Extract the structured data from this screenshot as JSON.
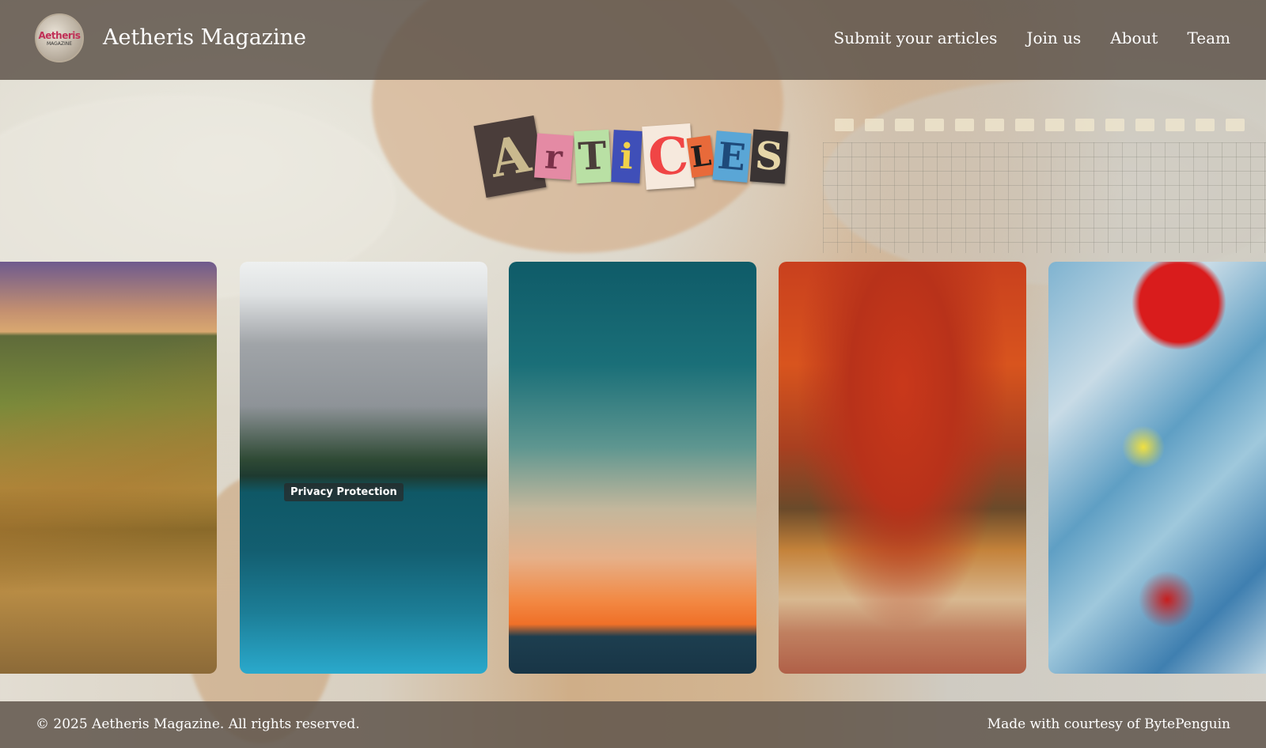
{
  "site": {
    "brand": "Aetheris Magazine",
    "logo_text_top": "Aetheris",
    "logo_text_bottom": "MAGAZINE"
  },
  "nav": {
    "items": [
      "Submit your articles",
      "Join us",
      "About",
      "Team"
    ]
  },
  "hero": {
    "title_letters": [
      "A",
      "r",
      "T",
      "i",
      "C",
      "L",
      "E",
      "S"
    ],
    "letter_colors": [
      "#4a3d3a",
      "#e48aa4",
      "#8ec87a",
      "#3f4fb8",
      "#f04545",
      "#e86a3a",
      "#5aa6d6",
      "#3a3434"
    ]
  },
  "gallery": {
    "cards": [
      {
        "alt": "Vineyard hills at sunset"
      },
      {
        "alt": "Mountain lake reflection",
        "badge": "Privacy Protection"
      },
      {
        "alt": "Teal and orange sunset sky"
      },
      {
        "alt": "Autumn forest path"
      },
      {
        "alt": "Abstract paint splatter"
      }
    ]
  },
  "footer": {
    "copyright": "© 2025 Aetheris Magazine. All rights reserved.",
    "credit": "Made with courtesy of BytePenguin"
  }
}
